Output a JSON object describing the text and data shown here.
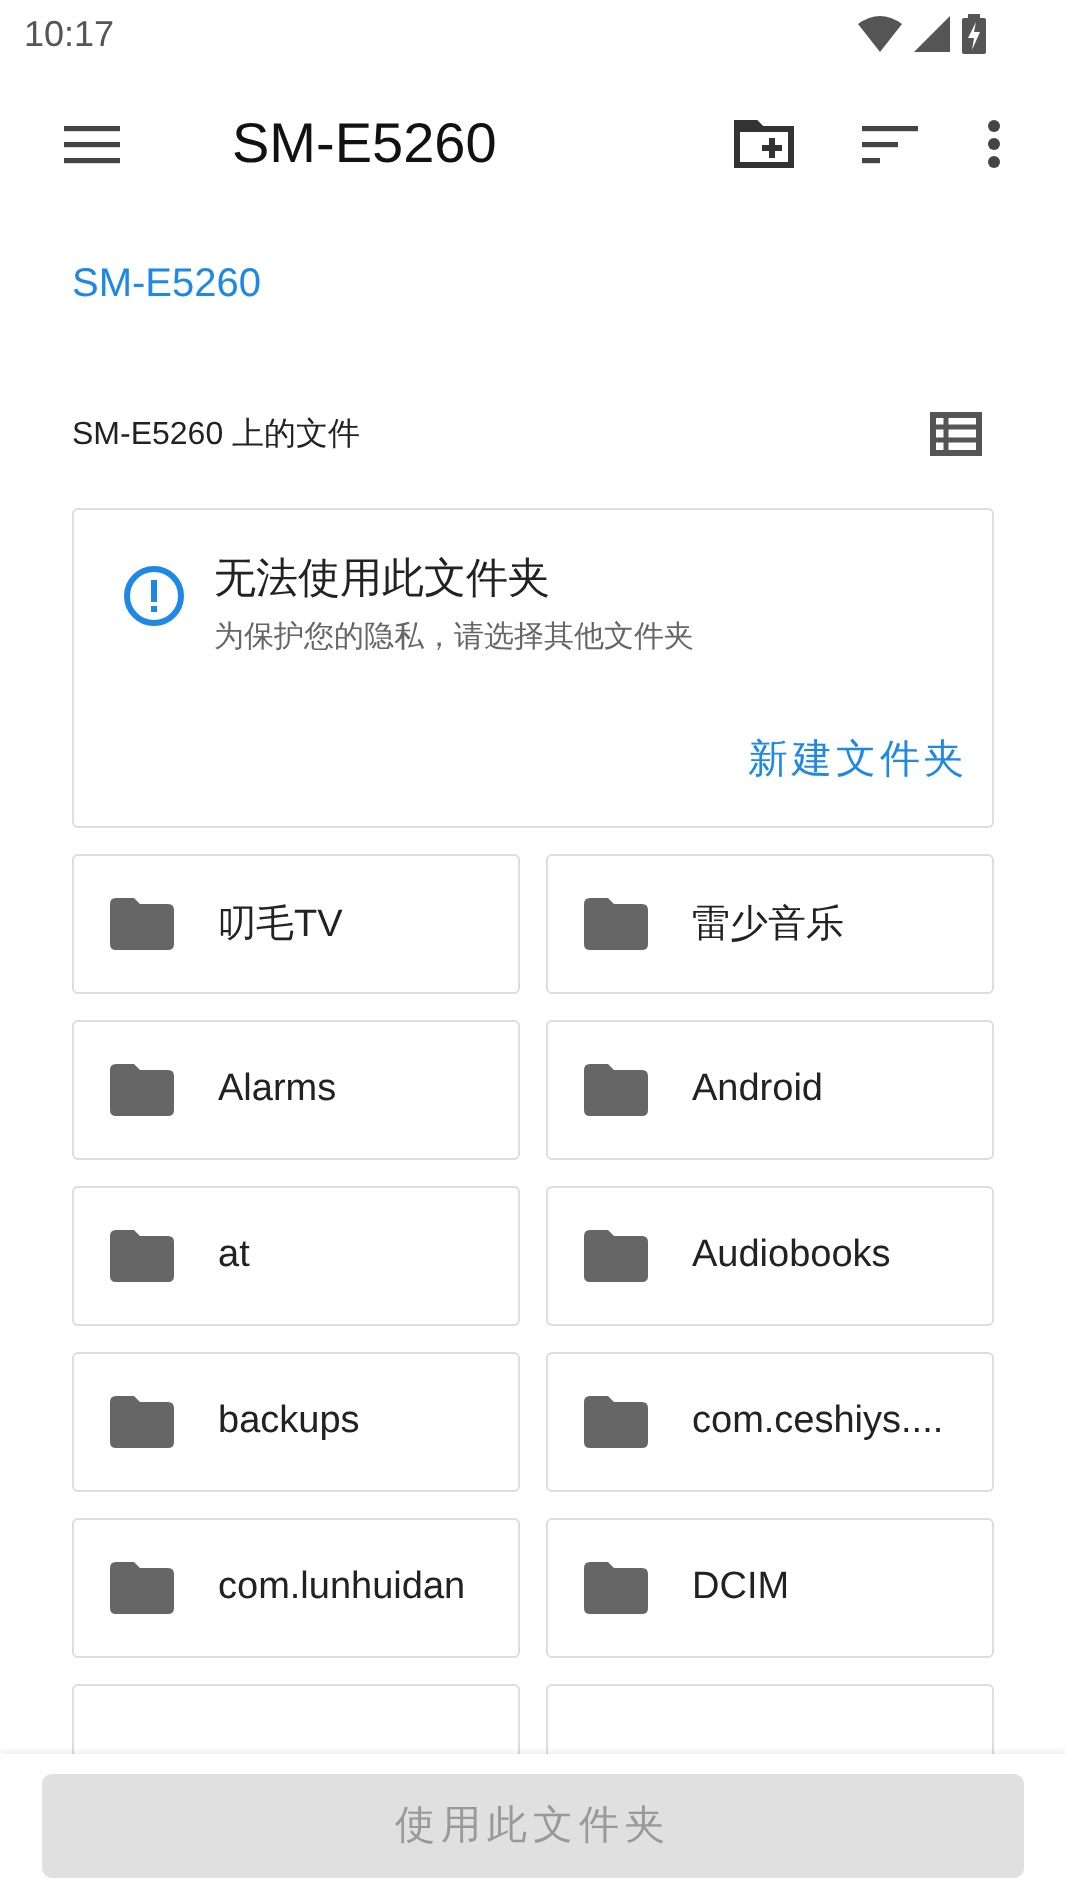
{
  "status_bar": {
    "time": "10:17"
  },
  "toolbar": {
    "title": "SM-E5260"
  },
  "breadcrumb": [
    {
      "label": "SM-E5260",
      "selected": true
    }
  ],
  "section": {
    "title": "SM-E5260 上的文件"
  },
  "notice": {
    "title": "无法使用此文件夹",
    "message": "为保护您的隐私，请选择其他文件夹",
    "action": "新建文件夹"
  },
  "folders": [
    {
      "kind": "folder",
      "name": "叨毛TV"
    },
    {
      "kind": "folder",
      "name": "雷少音乐"
    },
    {
      "kind": "folder",
      "name": "Alarms"
    },
    {
      "kind": "folder",
      "name": "Android"
    },
    {
      "kind": "folder",
      "name": "at"
    },
    {
      "kind": "folder",
      "name": "Audiobooks"
    },
    {
      "kind": "folder",
      "name": "backups"
    },
    {
      "kind": "folder",
      "name": "com.ceshiys...."
    },
    {
      "kind": "folder",
      "name": "com.lunhuidan"
    },
    {
      "kind": "folder",
      "name": "DCIM"
    },
    {
      "kind": "cut_off"
    },
    {
      "kind": "cut_off"
    }
  ],
  "bottom_button": {
    "label": "使用此文件夹",
    "disabled": true
  }
}
